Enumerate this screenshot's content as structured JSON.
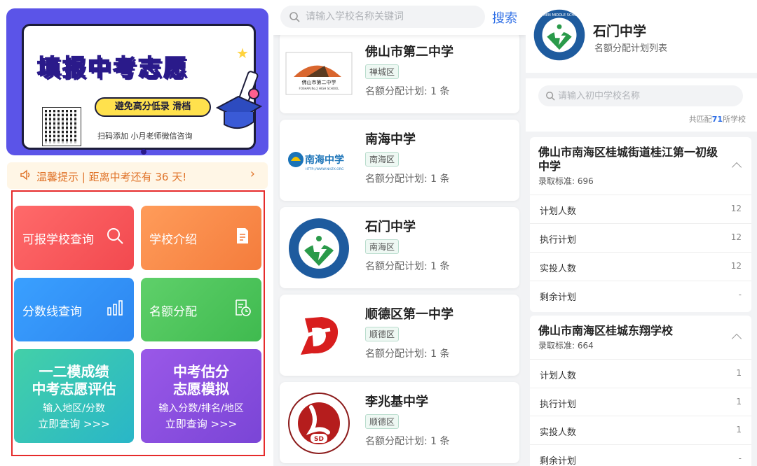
{
  "home": {
    "banner": {
      "title": "填报中考志愿",
      "pill": "避免高分低录  滑档",
      "scan": "扫码添加 小月老师微信咨询"
    },
    "notice": {
      "text": "温馨提示 | 距离中考还有 36 天!",
      "arrow": "›"
    },
    "tiles": [
      {
        "label": "可报学校查询",
        "icon": "search-icon"
      },
      {
        "label": "学校介绍",
        "icon": "document-icon"
      },
      {
        "label": "分数线查询",
        "icon": "bar-chart-icon"
      },
      {
        "label": "名额分配",
        "icon": "schedule-icon"
      }
    ],
    "big_tiles": [
      {
        "line1": "一二模成绩",
        "line2": "中考志愿评估",
        "sub": "输入地区/分数",
        "go": "立即查询 >>>"
      },
      {
        "line1": "中考估分",
        "line2": "志愿模拟",
        "sub": "输入分数/排名/地区",
        "go": "立即查询 >>>"
      }
    ]
  },
  "list": {
    "search_placeholder": "请输入学校名称关键词",
    "search_button": "搜索",
    "schools": [
      {
        "name": "佛山市第二中学",
        "district": "禅城区",
        "plan": "名额分配计划: 1 条",
        "logo_text": "佛山市第二中学",
        "logo_sub": "FOSHAN No.2 HIGH SCHOOL"
      },
      {
        "name": "南海中学",
        "district": "南海区",
        "plan": "名额分配计划: 1 条",
        "logo_text": "南海中学",
        "logo_sub": "HTTP://WWW.NHZX.ORG"
      },
      {
        "name": "石门中学",
        "district": "南海区",
        "plan": "名额分配计划: 1 条"
      },
      {
        "name": "顺德区第一中学",
        "district": "顺德区",
        "plan": "名额分配计划: 1 条"
      },
      {
        "name": "李兆基中学",
        "district": "顺德区",
        "plan": "名额分配计划: 1 条",
        "logo_text": "SD"
      }
    ]
  },
  "detail": {
    "school": "石门中学",
    "subtitle": "名额分配计划列表",
    "logo_text": "SHIMEN MIDDLE SCHOOL",
    "search_placeholder": "请输入初中学校名称",
    "count_prefix": "共匹配",
    "count": "71",
    "count_suffix": "所学校",
    "juniors": [
      {
        "name": "佛山市南海区桂城街道桂江第一初级中学",
        "standard": "录取标准: 696",
        "rows": [
          {
            "k": "计划人数",
            "v": "12"
          },
          {
            "k": "执行计划",
            "v": "12"
          },
          {
            "k": "实投人数",
            "v": "12"
          },
          {
            "k": "剩余计划",
            "v": "-"
          }
        ]
      },
      {
        "name": "佛山市南海区桂城东翔学校",
        "standard": "录取标准: 664",
        "rows": [
          {
            "k": "计划人数",
            "v": "1"
          },
          {
            "k": "执行计划",
            "v": "1"
          },
          {
            "k": "实投人数",
            "v": "1"
          },
          {
            "k": "剩余计划",
            "v": "-"
          }
        ]
      }
    ]
  },
  "colors": {
    "accent": "#2f6fe6",
    "notice": "#e0742a",
    "highlight": "#e62b2b"
  }
}
